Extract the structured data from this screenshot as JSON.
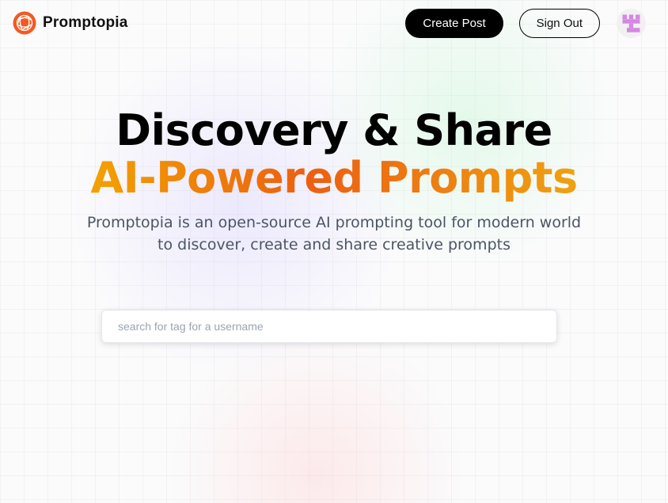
{
  "brand": {
    "name": "Promptopia",
    "logo_icon": "globe-logo-icon",
    "accent": "#f15a24"
  },
  "nav": {
    "create_post": "Create Post",
    "sign_out": "Sign Out",
    "avatar_icon": "identicon-avatar-icon"
  },
  "hero": {
    "title_line1": "Discovery & Share",
    "title_line2": "AI-Powered Prompts",
    "description": "Promptopia is an open-source AI prompting tool for modern world to discover, create and share creative prompts"
  },
  "search": {
    "placeholder": "search for tag for a username",
    "value": ""
  },
  "colors": {
    "gradient_start": "#f2a200",
    "gradient_mid": "#ec5f12",
    "gradient_end": "#eea211",
    "avatar_pattern": "#d488e2",
    "text_gray": "#4b5563"
  }
}
